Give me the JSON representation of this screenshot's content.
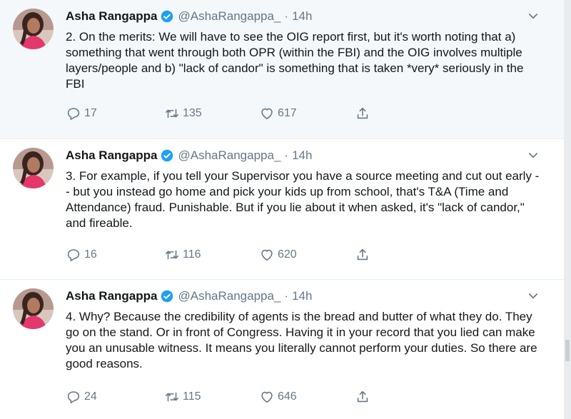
{
  "tweets": [
    {
      "name": "Asha Rangappa",
      "handle": "@AshaRangappa_",
      "separator": "·",
      "time": "14h",
      "text": "2. On the merits: We will have to see the OIG report first, but it's worth noting that a) something that went through both OPR (within the FBI) and the OIG involves multiple layers/people and b) \"lack of candor\" is something that is taken *very* seriously in the FBI",
      "replies": "17",
      "retweets": "135",
      "likes": "617"
    },
    {
      "name": "Asha Rangappa",
      "handle": "@AshaRangappa_",
      "separator": "·",
      "time": "14h",
      "text": "3. For example, if you tell your Supervisor you have a source meeting and cut out early -- but you instead go home and pick your kids up from school, that's T&A (Time and Attendance) fraud. Punishable. But if you lie about it when asked, it's \"lack of candor,\" and fireable.",
      "replies": "16",
      "retweets": "116",
      "likes": "620"
    },
    {
      "name": "Asha Rangappa",
      "handle": "@AshaRangappa_",
      "separator": "·",
      "time": "14h",
      "text": "4. Why? Because the credibility of agents is the bread and butter of what they do. They go on the stand. Or in front of Congress. Having it in your record that you lied can make you an unusable witness. It means you literally cannot perform your duties. So there are good reasons.",
      "replies": "24",
      "retweets": "115",
      "likes": "646"
    }
  ],
  "icons": {
    "verified": "verified-badge-icon",
    "caret": "chevron-down-icon",
    "reply": "reply-icon",
    "retweet": "retweet-icon",
    "like": "heart-icon",
    "share": "share-icon"
  },
  "colors": {
    "accent": "#1da1f2",
    "muted": "#657786",
    "highlight_bg": "#f5f8fa",
    "avatar_top": "#c45a6e",
    "avatar_shirt": "#e4386c"
  }
}
